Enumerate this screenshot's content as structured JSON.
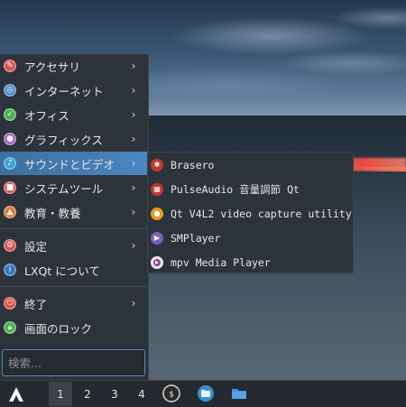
{
  "menu": {
    "items": [
      {
        "label": "アクセサリ",
        "icon": "accessories-icon",
        "color": "#d9534f",
        "submenu": true
      },
      {
        "label": "インターネット",
        "icon": "internet-icon",
        "color": "#4a89c8",
        "submenu": true
      },
      {
        "label": "オフィス",
        "icon": "office-icon",
        "color": "#4caf50",
        "submenu": true
      },
      {
        "label": "グラフィックス",
        "icon": "graphics-icon",
        "color": "#a060c0",
        "submenu": true
      },
      {
        "label": "サウンドとビデオ",
        "icon": "sound-video-icon",
        "color": "#3fa0d8",
        "submenu": true,
        "active": true
      },
      {
        "label": "システムツール",
        "icon": "system-tools-icon",
        "color": "#d9534f",
        "submenu": true
      },
      {
        "label": "教育・教養",
        "icon": "education-icon",
        "color": "#d97a3a",
        "submenu": true
      }
    ],
    "settings_label": "設定",
    "about_label": "LXQt について",
    "quit_label": "終了",
    "lock_label": "画面のロック",
    "search_placeholder": "検索..."
  },
  "submenu": {
    "items": [
      {
        "label": "Brasero",
        "icon": "brasero-icon",
        "color": "#c0392b"
      },
      {
        "label": "PulseAudio 音量調節 Qt",
        "icon": "pulseaudio-icon",
        "color": "#c0392b"
      },
      {
        "label": "Qt V4L2 video capture utility",
        "icon": "qv4l2-icon",
        "color": "#e0a020"
      },
      {
        "label": "SMPlayer",
        "icon": "smplayer-icon",
        "color": "#7a5fc0"
      },
      {
        "label": "mpv Media Player",
        "icon": "mpv-icon",
        "color": "#8e3fa0"
      }
    ]
  },
  "taskbar": {
    "workspaces": [
      "1",
      "2",
      "3",
      "4"
    ],
    "active_workspace": "1",
    "launchers": [
      "terminal-icon",
      "file-manager-icon",
      "folder-icon"
    ]
  },
  "colors": {
    "accent": "#4a86c0",
    "menu_bg": "#2d333b",
    "taskbar_bg": "#252a30"
  }
}
